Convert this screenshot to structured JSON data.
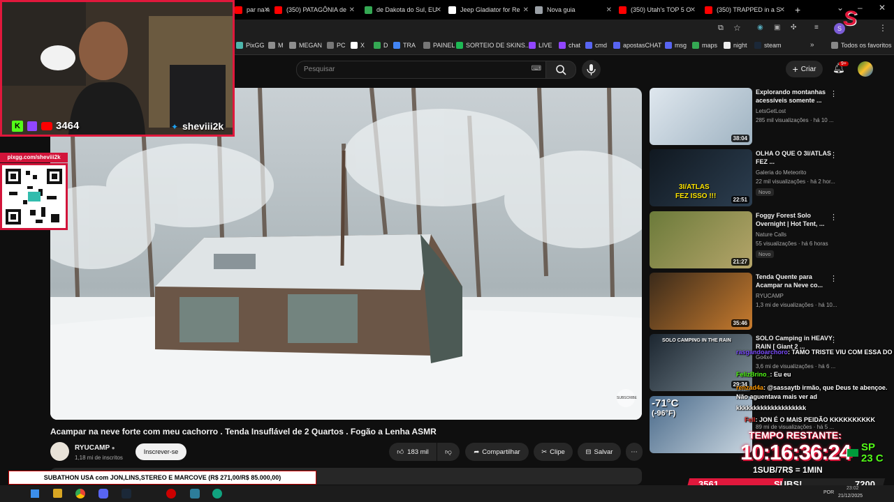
{
  "tabs": [
    {
      "title": "par na ne",
      "favicon_color": "#ff0000"
    },
    {
      "title": "(350) PATAGÔNIA de",
      "favicon_color": "#ff0000"
    },
    {
      "title": "de Dakota do Sul, EU",
      "favicon_color": "#34a853"
    },
    {
      "title": "Jeep Gladiator for Re",
      "favicon_color": "#ffffff"
    },
    {
      "title": "Nova guia",
      "favicon_color": "#9aa0a6"
    },
    {
      "title": "(350) Utah's TOP 5 O",
      "favicon_color": "#ff0000"
    },
    {
      "title": "(350) TRAPPED in a S",
      "favicon_color": "#ff0000"
    }
  ],
  "bookmarks": [
    {
      "label": "PixGG",
      "color": "#4db6ac"
    },
    {
      "label": "M",
      "color": "#8e8e8e"
    },
    {
      "label": "MEGAN",
      "color": "#8e8e8e"
    },
    {
      "label": "PC",
      "color": "#777"
    },
    {
      "label": "X",
      "color": "#ffffff"
    },
    {
      "label": "D",
      "color": "#34a853"
    },
    {
      "label": "TRA",
      "color": "#4285f4"
    },
    {
      "label": "PAINEL",
      "color": "#777"
    },
    {
      "label": "SORTEIO DE SKINS...",
      "color": "#1db954"
    },
    {
      "label": "LIVE",
      "color": "#9146ff"
    },
    {
      "label": "chat",
      "color": "#9146ff"
    },
    {
      "label": "cmd",
      "color": "#5865f2"
    },
    {
      "label": "apostasCHAT",
      "color": "#5865f2"
    },
    {
      "label": "msg",
      "color": "#5865f2"
    },
    {
      "label": "maps",
      "color": "#34a853"
    },
    {
      "label": "night",
      "color": "#eee"
    },
    {
      "label": "steam",
      "color": "#1b2838"
    }
  ],
  "bookmarks_other": "Todos os favoritos",
  "search": {
    "placeholder": "Pesquisar"
  },
  "create_label": "Criar",
  "notif_badge": "9+",
  "video": {
    "title": "Acampar na neve forte com meu cachorro . Tenda Insuflável de 2 Quartos . Fogão a Lenha ASMR",
    "channel": "RYUCAMP",
    "subscribers": "1,18 mi de inscritos",
    "subscribe_label": "Inscrever-se",
    "likes": "183 mil",
    "share_label": "Compartilhar",
    "clip_label": "Clipe",
    "save_label": "Salvar",
    "watermark": "SUBSCRIBE"
  },
  "recommendations": [
    {
      "title": "Explorando montanhas acessíveis somente ...",
      "channel": "LetsGetLost",
      "meta": "285 mil visualizações · há 10 ...",
      "duration": "38:04",
      "new": ""
    },
    {
      "title": "OLHA O QUE O 3I/ATLAS FEZ ...",
      "channel": "Galeria do Meteorito",
      "meta": "22 mil visualizações · há 2 hor...",
      "duration": "22:51",
      "new": "Novo"
    },
    {
      "title": "Foggy Forest Solo Overnight | Hot Tent, ...",
      "channel": "Nature Calls",
      "meta": "55 visualizações · há 6 horas",
      "duration": "21:27",
      "new": "Novo"
    },
    {
      "title": "Tenda Quente para Acampar na Neve co...",
      "channel": "RYUCAMP",
      "meta": "1,3 mi de visualizações · há 10...",
      "duration": "35:46",
      "new": ""
    },
    {
      "title": "SOLO Camping in HEAVY RAIN [ Giant 2 ...",
      "channel": "Go4x4",
      "meta": "3,6 mi de visualizações · há 6 ...",
      "duration": "29:34",
      "new": ""
    },
    {
      "title": "",
      "channel": "",
      "meta": "89 mi de visualizações · há 5 ...",
      "duration": "",
      "new": ""
    }
  ],
  "thumb_text": {
    "t1": "SOLO CAMPING IN THE RAIN",
    "t2a": "3I/ATLAS",
    "t2b": "FEZ ISSO !!!",
    "t3": "-71°C",
    "t4": "(-96°F)"
  },
  "stream": {
    "viewers": "3464",
    "handle": "sheviii2k",
    "pix_url": "pixgg.com/sheviii2k",
    "subathon_banner": "SUBATHON USA com JON,LINS,STEREO E MARCOVE (R$ 271,00/R$ 85.000,00)",
    "timer_label": "TEMPO RESTANTE:",
    "timer": "10:16:36:24",
    "sub_rule": "1SUB/7R$ = 1MIN",
    "location": "SP",
    "temperature": "23 C",
    "subs_left": "3561",
    "subs_label": "SUBS!",
    "subs_right": "7200"
  },
  "chat": [
    {
      "user": "rasgandoarchoro",
      "msg": ": TAMO TRISTE VIU COM ESSA DO LINS"
    },
    {
      "user": "FelizBrino_",
      "msg": ": Eu eu"
    },
    {
      "user": "renzad4a",
      "msg": ": @sassaytb irmão, que Deus te abençoe. Não aguentava mais ver ad"
    },
    {
      "user": "",
      "msg": "kkkkkkkkkkkkkkkkkkkk"
    },
    {
      "user": "Fell",
      "msg": ": JON É O MAIS PEIDÃO KKKKKKKKKK"
    }
  ],
  "taskbar": {
    "lang": "POR",
    "time": "23:02",
    "date": "21/12/2025"
  },
  "colors": {
    "accent": "#ff0000",
    "twitch": "#9146ff",
    "kick": "#53fc18",
    "stream_red": "#e0183c"
  }
}
